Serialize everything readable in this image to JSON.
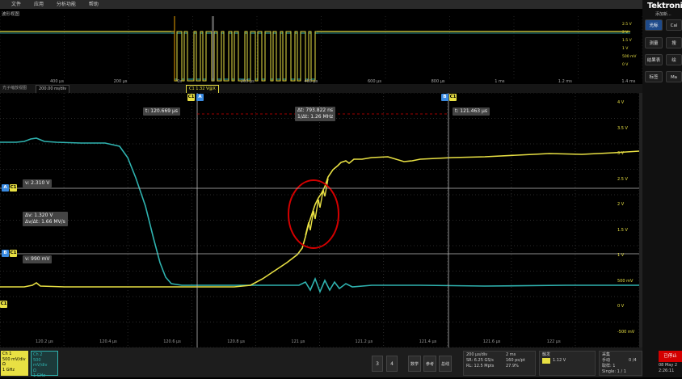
{
  "menu": [
    "文件",
    "应用",
    "分析功能",
    "帮助"
  ],
  "brand": {
    "name": "Tektronix",
    "sub": "添加新..."
  },
  "overview": {
    "label": "波形视图",
    "x_ticks": [
      "400 μs",
      "200 μs",
      "0s",
      "200 μs",
      "400 μs",
      "600 μs",
      "800 μs",
      "1 ms",
      "1.2 ms",
      "1.4 ms"
    ],
    "right_labels": [
      "2.5 V",
      "2 V",
      "1.5 V",
      "1 V",
      "500 mV",
      "0 V"
    ]
  },
  "toolbar": {
    "zoom_label": "光子缩放视图",
    "zoom_value": "200.00 ns/div",
    "cursor1": "C1 1.32 V@X",
    "c1": "C1"
  },
  "cursors": {
    "t1": "t: 120.669 μs",
    "t2": "t: 121.463 μs",
    "delta_t": "Δt: 793.822 ns",
    "inv_delta_t": "1/Δt: 1.26 MHz",
    "va": "v: 2.310 V",
    "vb": "v: 990 mV",
    "delta_v": "Δv: 1.320 V",
    "slew": "Δv/Δt: 1.66 MV/s"
  },
  "markers": {
    "A": "A",
    "B": "B",
    "C1": "C1",
    "ch1": "1"
  },
  "y_labels": [
    "4 V",
    "3.5 V",
    "3 V",
    "2.5 V",
    "2 V",
    "1.5 V",
    "1 V",
    "500 mV",
    "0 V",
    "-500 mV"
  ],
  "x_labels": [
    "120.2 μs",
    "120.4 μs",
    "120.6 μs",
    "120.8 μs",
    "121 μs",
    "121.2 μs",
    "121.4 μs",
    "121.6 μs",
    "122 μs"
  ],
  "channels": {
    "ch1": {
      "name": "Ch 1",
      "scale": "500 mV/div",
      "coupling": "Ω",
      "bw": "1 GHz"
    },
    "ch2": {
      "name": "Ch 2",
      "scale": "500 mV/div",
      "coupling": "Ω",
      "bw": "1 GHz"
    }
  },
  "bottom_buttons": [
    "3",
    "4",
    "数学",
    "参考",
    "总线"
  ],
  "horizontal": {
    "l1": "200 μs/div",
    "l2": "SR: 6.25 GS/s",
    "l3": "RL: 12.5 Mpts",
    "r1": "2 ms",
    "r2": "160 ps/pt",
    "r3": "27.9%"
  },
  "trigger": {
    "label": "触发",
    "value": "1.12 V"
  },
  "acq": {
    "label": "采集",
    "l1": "手动",
    "l2": "取样: 1",
    "l3": "Single: 1 / 1",
    "r1": "0 /4"
  },
  "stop_button": "已停止",
  "datetime": {
    "date": "08 May 2",
    "time": "2:26:11"
  },
  "side_buttons": [
    "光标",
    "Cal",
    "测量",
    "搜",
    "结果表",
    "绘",
    "标签",
    "Ma"
  ],
  "colors": {
    "ch1": "#e8e043",
    "ch2": "#2fb3b0",
    "highlight": "#d40000"
  }
}
